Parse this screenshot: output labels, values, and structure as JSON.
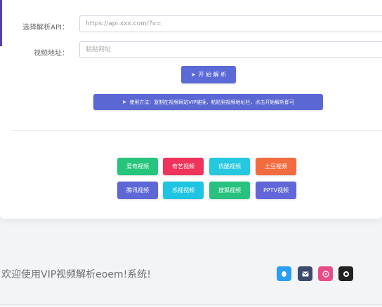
{
  "form": {
    "api_label": "选择解析API：",
    "api_value": "https://api.xxx.com/?v=",
    "url_label": "视频地址：",
    "url_placeholder": "粘贴网址"
  },
  "actions": {
    "parse_label": "开 始 解 析",
    "usage_label": "使用方法：复制在视频网站VIP链接，粘贴到视频地址栏，点击开始解析即可"
  },
  "platforms": [
    {
      "label": "爱奇视频",
      "color": "#27c57c"
    },
    {
      "label": "奇艺视频",
      "color": "#f0335a"
    },
    {
      "label": "优酷视频",
      "color": "#25c8de"
    },
    {
      "label": "土豆视频",
      "color": "#f36c3f"
    },
    {
      "label": "腾讯视频",
      "color": "#5d67d6"
    },
    {
      "label": "乐视视频",
      "color": "#1fc4e2"
    },
    {
      "label": "搜狐视频",
      "color": "#28c27e"
    },
    {
      "label": "PPTV视频",
      "color": "#6167d8"
    }
  ],
  "footer": {
    "text": "欢迎使用VIP视频解析eoem!系统!",
    "social": [
      {
        "icon": "qq-icon",
        "color": "#2a9df4"
      },
      {
        "icon": "mail-icon",
        "color": "#3b4a6d"
      },
      {
        "icon": "dribbble-icon",
        "color": "#e84c88"
      },
      {
        "icon": "github-icon",
        "color": "#222222"
      }
    ]
  }
}
